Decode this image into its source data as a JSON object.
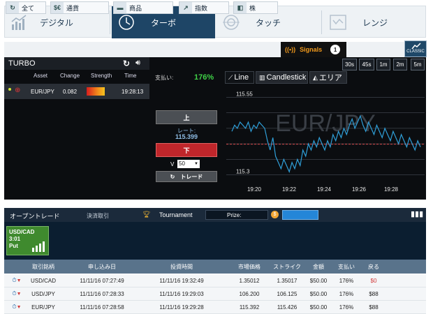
{
  "top_tabs": [
    {
      "label": "デジタル",
      "icon": "digital-chart-icon"
    },
    {
      "label": "ターボ",
      "icon": "clock-icon"
    },
    {
      "label": "タッチ",
      "icon": "target-icon"
    },
    {
      "label": "レンジ",
      "icon": "range-icon"
    }
  ],
  "asset_tabs": [
    "全て",
    "通貨",
    "商品",
    "指数",
    "株"
  ],
  "asset_tab_icons": [
    "$€"
  ],
  "signals": {
    "label": "Signals",
    "count": "1"
  },
  "classic": "CLASSIC",
  "turbo": {
    "title": "TURBO",
    "columns": [
      "Asset",
      "Change",
      "Strength",
      "Time"
    ],
    "row": {
      "asset": "EUR/JPY",
      "change": "0.082",
      "strength": 0.55,
      "time": "19:28:13"
    }
  },
  "trade": {
    "payout_label": "支払い:",
    "payout_value": "176%",
    "up_label": "上",
    "rate_label": "レート:",
    "rate_value": "115.399",
    "down_label": "下",
    "amount_prefix": "V",
    "amount_value": "50",
    "trade_label": "トレード"
  },
  "chart": {
    "tabs": [
      "Line",
      "Candlestick",
      "エリア"
    ],
    "ranges": [
      "30s",
      "45s",
      "1m",
      "2m",
      "5m"
    ],
    "watermark": "EUR/JPY"
  },
  "chart_data": {
    "type": "line",
    "title": "",
    "xlabel": "",
    "ylabel": "",
    "x_ticks": [
      "19:20",
      "19:22",
      "19:24",
      "19:26",
      "19:28"
    ],
    "y_ticks": [
      115.55,
      115.3
    ],
    "ylim": [
      115.27,
      115.58
    ],
    "reference_line": 115.399,
    "series": [
      {
        "name": "",
        "color": "#2f9fd8",
        "values": [
          115.44,
          115.46,
          115.45,
          115.47,
          115.46,
          115.45,
          115.47,
          115.44,
          115.46,
          115.45,
          115.47,
          115.46,
          115.45,
          115.41,
          115.38,
          115.42,
          115.36,
          115.34,
          115.32,
          115.35,
          115.33,
          115.31,
          115.34,
          115.32,
          115.35,
          115.33,
          115.38,
          115.36,
          115.4,
          115.38,
          115.41,
          115.39,
          115.42,
          115.4,
          115.38,
          115.41,
          115.39,
          115.43,
          115.41,
          115.44,
          115.42,
          115.45,
          115.43,
          115.46,
          115.48,
          115.45,
          115.47,
          115.49,
          115.46,
          115.44,
          115.47,
          115.45,
          115.43,
          115.46,
          115.44,
          115.42,
          115.45,
          115.43,
          115.41,
          115.44,
          115.42,
          115.4,
          115.43,
          115.41,
          115.39,
          115.42,
          115.4,
          115.38,
          115.41,
          115.39
        ]
      }
    ]
  },
  "bottom": {
    "tabs": [
      "オープントレード",
      "決済取引"
    ],
    "tournament": "Tournament",
    "prize": "Prize:",
    "card": {
      "pair": "USD/CAD",
      "time": "3:01",
      "dir": "Put"
    },
    "columns": [
      "取引銘柄",
      "申し込み日",
      "投資時間",
      "市場価格",
      "ストライク",
      "金額",
      "支払い",
      "戻る"
    ],
    "rows": [
      [
        "USD/CAD",
        "11/11/16 07:27:49",
        "11/11/16 19:32:49",
        "1.35012",
        "1.35017",
        "$50.00",
        "176%",
        "$0"
      ],
      [
        "USD/JPY",
        "11/11/16 07:28:33",
        "11/11/16 19:29:03",
        "106.200",
        "106.125",
        "$50.00",
        "176%",
        "$88"
      ],
      [
        "EUR/JPY",
        "11/11/16 07:28:58",
        "11/11/16 19:29:28",
        "115.392",
        "115.426",
        "$50.00",
        "176%",
        "$88"
      ]
    ]
  },
  "colors": {
    "accent": "#1e4566",
    "up": "#4b4f54",
    "down": "#c0262b",
    "payout": "#3fd147",
    "line": "#2f9fd8",
    "reference": "#d94848",
    "signals": "#f29a1c",
    "return_zero": "#d23a3a"
  }
}
